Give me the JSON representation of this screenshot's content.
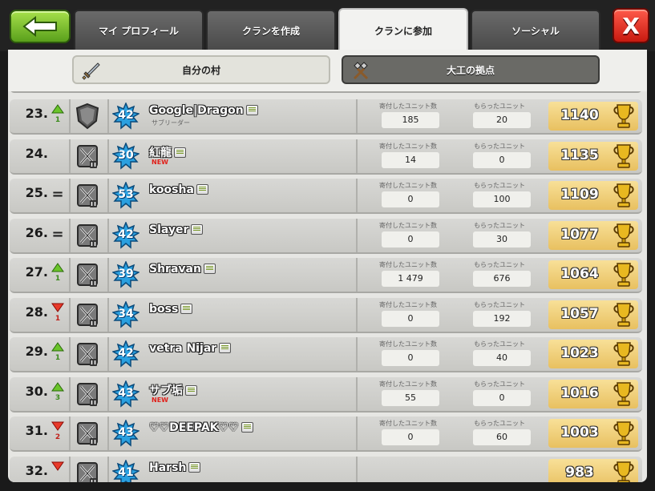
{
  "nav": {
    "tabs": [
      {
        "label": "マイ プロフィール",
        "active": false
      },
      {
        "label": "クランを作成",
        "active": false
      },
      {
        "label": "クランに参加",
        "active": true
      },
      {
        "label": "ソーシャル",
        "active": false
      }
    ],
    "close_label": "X"
  },
  "subtabs": [
    {
      "label": "自分の村",
      "icon": "sword-icon",
      "selected": true
    },
    {
      "label": "大工の拠点",
      "icon": "crossed-hammers-icon",
      "selected": false
    }
  ],
  "stat_labels": {
    "donated": "寄付したユニット数",
    "received": "もらったユニット"
  },
  "members": [
    {
      "rank": "23.",
      "trend": "up",
      "trend_num": "1",
      "level": "42",
      "name": "Google|Dragon",
      "sub": "サブリーダー",
      "donated": "185",
      "received": "20",
      "trophies": "1140",
      "badge": "shield-icon"
    },
    {
      "rank": "24.",
      "trend": "none",
      "trend_num": "",
      "level": "30",
      "name": "紅龍",
      "sub": "NEW",
      "donated": "14",
      "received": "0",
      "trophies": "1135",
      "badge": "swords-badge-icon"
    },
    {
      "rank": "25.",
      "trend": "same",
      "trend_num": "",
      "level": "53",
      "name": "koosha",
      "sub": "",
      "donated": "0",
      "received": "100",
      "trophies": "1109",
      "badge": "swords-badge-icon"
    },
    {
      "rank": "26.",
      "trend": "same",
      "trend_num": "",
      "level": "42",
      "name": "Slayer",
      "sub": "",
      "donated": "0",
      "received": "30",
      "trophies": "1077",
      "badge": "swords-badge-icon"
    },
    {
      "rank": "27.",
      "trend": "up",
      "trend_num": "1",
      "level": "39",
      "name": "Shravan",
      "sub": "",
      "donated": "1 479",
      "received": "676",
      "trophies": "1064",
      "badge": "swords-badge-icon"
    },
    {
      "rank": "28.",
      "trend": "down",
      "trend_num": "1",
      "level": "34",
      "name": "boss",
      "sub": "",
      "donated": "0",
      "received": "192",
      "trophies": "1057",
      "badge": "swords-badge-icon"
    },
    {
      "rank": "29.",
      "trend": "up",
      "trend_num": "1",
      "level": "42",
      "name": "vetra Nijar",
      "sub": "",
      "donated": "0",
      "received": "40",
      "trophies": "1023",
      "badge": "swords-badge-icon"
    },
    {
      "rank": "30.",
      "trend": "up",
      "trend_num": "3",
      "level": "43",
      "name": "サブ垢",
      "sub": "NEW",
      "donated": "55",
      "received": "0",
      "trophies": "1016",
      "badge": "swords-badge-icon"
    },
    {
      "rank": "31.",
      "trend": "down",
      "trend_num": "2",
      "level": "43",
      "name": "♡♡DEEPAK♡♡",
      "sub": "",
      "donated": "0",
      "received": "60",
      "trophies": "1003",
      "badge": "swords-badge-icon"
    },
    {
      "rank": "32.",
      "trend": "down",
      "trend_num": "",
      "level": "41",
      "name": "Harsh",
      "sub": "",
      "donated": "",
      "received": "",
      "trophies": "983",
      "badge": "swords-badge-icon"
    }
  ]
}
